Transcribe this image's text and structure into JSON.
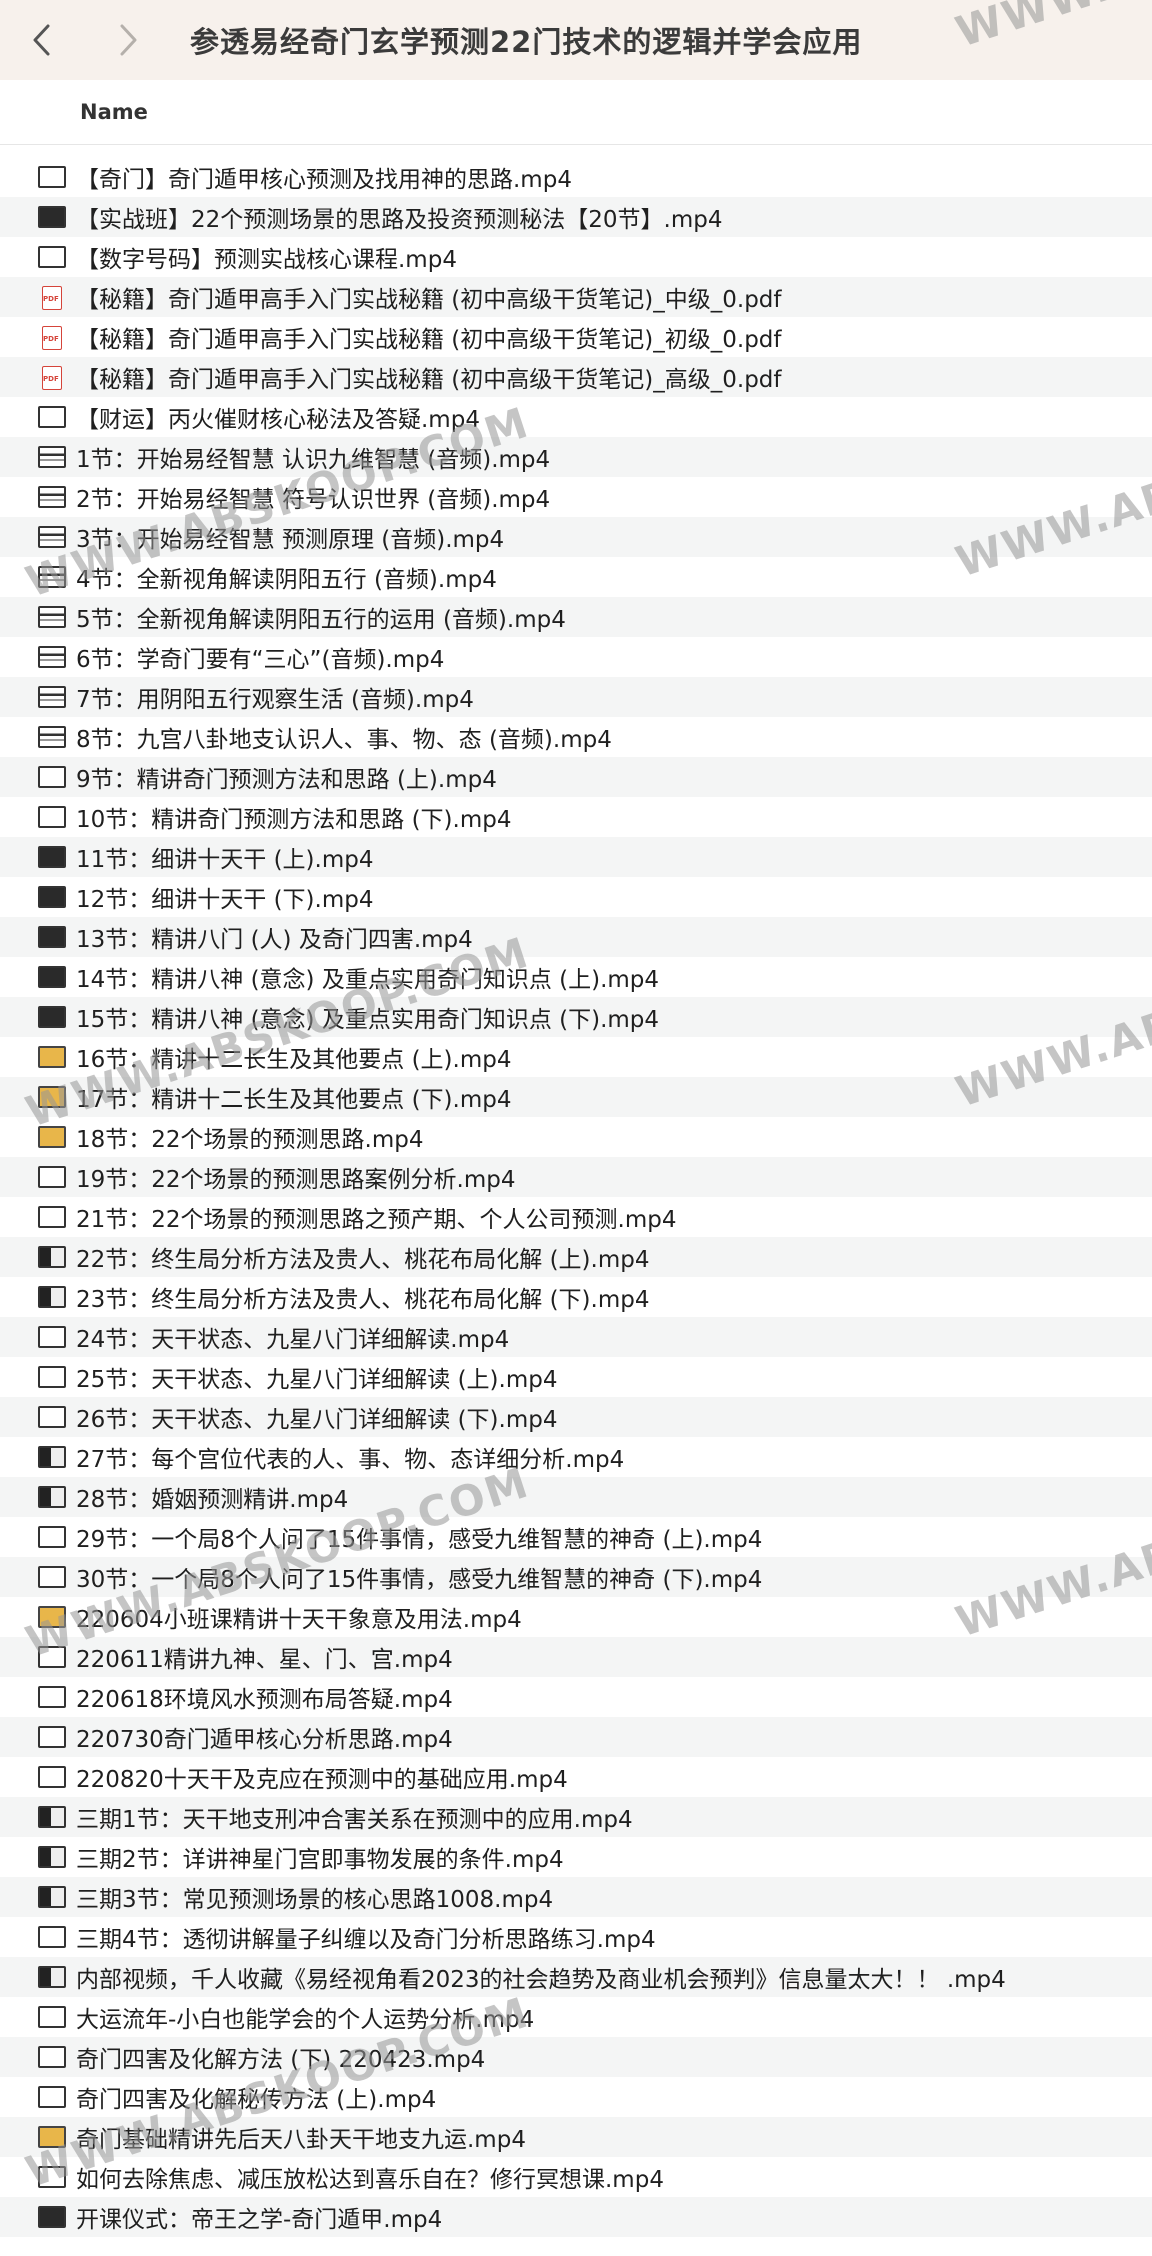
{
  "window": {
    "title": "参透易经奇门玄学预测22门技术的逻辑并学会应用"
  },
  "columns": {
    "name": "Name"
  },
  "watermark": "WWW.ABSKOOP.COM",
  "files": [
    {
      "name": "【奇门】奇门遁甲核心预测及找用神的思路.mp4",
      "icon": "video-icon",
      "style": "plain"
    },
    {
      "name": "【实战班】22个预测场景的思路及投资预测秘法【20节】.mp4",
      "icon": "video-icon",
      "style": "dark"
    },
    {
      "name": "【数字号码】预测实战核心课程.mp4",
      "icon": "video-icon",
      "style": "plain"
    },
    {
      "name": "【秘籍】奇门遁甲高手入门实战秘籍 (初中高级干货笔记)_中级_0.pdf",
      "icon": "pdf-icon",
      "style": "pdf"
    },
    {
      "name": "【秘籍】奇门遁甲高手入门实战秘籍 (初中高级干货笔记)_初级_0.pdf",
      "icon": "pdf-icon",
      "style": "pdf"
    },
    {
      "name": "【秘籍】奇门遁甲高手入门实战秘籍 (初中高级干货笔记)_高级_0.pdf",
      "icon": "pdf-icon",
      "style": "pdf"
    },
    {
      "name": "【财运】丙火催财核心秘法及答疑.mp4",
      "icon": "video-icon",
      "style": "plain"
    },
    {
      "name": "1节：开始易经智慧 认识九维智慧 (音频).mp4",
      "icon": "video-icon",
      "style": "stripe"
    },
    {
      "name": "2节：开始易经智慧 符号认识世界 (音频).mp4",
      "icon": "video-icon",
      "style": "stripe"
    },
    {
      "name": "3节：开始易经智慧 预测原理 (音频).mp4",
      "icon": "video-icon",
      "style": "stripe"
    },
    {
      "name": "4节：全新视角解读阴阳五行 (音频).mp4",
      "icon": "video-icon",
      "style": "stripe"
    },
    {
      "name": "5节：全新视角解读阴阳五行的运用 (音频).mp4",
      "icon": "video-icon",
      "style": "stripe"
    },
    {
      "name": "6节：学奇门要有“三心”(音频).mp4",
      "icon": "video-icon",
      "style": "stripe"
    },
    {
      "name": "7节：用阴阳五行观察生活 (音频).mp4",
      "icon": "video-icon",
      "style": "stripe"
    },
    {
      "name": "8节：九宫八卦地支认识人、事、物、态 (音频).mp4",
      "icon": "video-icon",
      "style": "stripe"
    },
    {
      "name": "9节：精讲奇门预测方法和思路 (上).mp4",
      "icon": "video-icon",
      "style": "plain"
    },
    {
      "name": "10节：精讲奇门预测方法和思路 (下).mp4",
      "icon": "video-icon",
      "style": "plain"
    },
    {
      "name": "11节：细讲十天干 (上).mp4",
      "icon": "video-icon",
      "style": "dark"
    },
    {
      "name": "12节：细讲十天干 (下).mp4",
      "icon": "video-icon",
      "style": "dark"
    },
    {
      "name": "13节：精讲八门 (人) 及奇门四害.mp4",
      "icon": "video-icon",
      "style": "dark"
    },
    {
      "name": "14节：精讲八神 (意念) 及重点实用奇门知识点 (上).mp4",
      "icon": "video-icon",
      "style": "dark"
    },
    {
      "name": "15节：精讲八神 (意念) 及重点实用奇门知识点 (下).mp4",
      "icon": "video-icon",
      "style": "dark"
    },
    {
      "name": "16节：精讲十二长生及其他要点 (上).mp4",
      "icon": "video-icon",
      "style": "gold"
    },
    {
      "name": "17节：精讲十二长生及其他要点 (下).mp4",
      "icon": "video-icon",
      "style": "gold"
    },
    {
      "name": "18节：22个场景的预测思路.mp4",
      "icon": "video-icon",
      "style": "gold"
    },
    {
      "name": "19节：22个场景的预测思路案例分析.mp4",
      "icon": "video-icon",
      "style": "plain"
    },
    {
      "name": "21节：22个场景的预测思路之预产期、个人公司预测.mp4",
      "icon": "video-icon",
      "style": "plain"
    },
    {
      "name": "22节：终生局分析方法及贵人、桃花布局化解 (上).mp4",
      "icon": "video-icon",
      "style": "half"
    },
    {
      "name": "23节：终生局分析方法及贵人、桃花布局化解 (下).mp4",
      "icon": "video-icon",
      "style": "half"
    },
    {
      "name": "24节：天干状态、九星八门详细解读.mp4",
      "icon": "video-icon",
      "style": "plain"
    },
    {
      "name": "25节：天干状态、九星八门详细解读 (上).mp4",
      "icon": "video-icon",
      "style": "plain"
    },
    {
      "name": "26节：天干状态、九星八门详细解读 (下).mp4",
      "icon": "video-icon",
      "style": "plain"
    },
    {
      "name": "27节：每个宫位代表的人、事、物、态详细分析.mp4",
      "icon": "video-icon",
      "style": "half"
    },
    {
      "name": "28节：婚姻预测精讲.mp4",
      "icon": "video-icon",
      "style": "half"
    },
    {
      "name": "29节：一个局8个人问了15件事情，感受九维智慧的神奇 (上).mp4",
      "icon": "video-icon",
      "style": "plain"
    },
    {
      "name": "30节：一个局8个人问了15件事情，感受九维智慧的神奇 (下).mp4",
      "icon": "video-icon",
      "style": "plain"
    },
    {
      "name": "220604小班课精讲十天干象意及用法.mp4",
      "icon": "video-icon",
      "style": "gold"
    },
    {
      "name": "220611精讲九神、星、门、宫.mp4",
      "icon": "video-icon",
      "style": "plain"
    },
    {
      "name": "220618环境风水预测布局答疑.mp4",
      "icon": "video-icon",
      "style": "plain"
    },
    {
      "name": "220730奇门遁甲核心分析思路.mp4",
      "icon": "video-icon",
      "style": "plain"
    },
    {
      "name": "220820十天干及克应在预测中的基础应用.mp4",
      "icon": "video-icon",
      "style": "plain"
    },
    {
      "name": "三期1节：天干地支刑冲合害关系在预测中的应用.mp4",
      "icon": "video-icon",
      "style": "half"
    },
    {
      "name": "三期2节：详讲神星门宫即事物发展的条件.mp4",
      "icon": "video-icon",
      "style": "half"
    },
    {
      "name": "三期3节：常见预测场景的核心思路1008.mp4",
      "icon": "video-icon",
      "style": "half"
    },
    {
      "name": "三期4节：透彻讲解量子纠缠以及奇门分析思路练习.mp4",
      "icon": "video-icon",
      "style": "plain"
    },
    {
      "name": "内部视频，千人收藏《易经视角看2023的社会趋势及商业机会预判》信息量太大！！ .mp4",
      "icon": "video-icon",
      "style": "half"
    },
    {
      "name": "大运流年-小白也能学会的个人运势分析.mp4",
      "icon": "video-icon",
      "style": "plain"
    },
    {
      "name": "奇门四害及化解方法 (下) 220423.mp4",
      "icon": "video-icon",
      "style": "plain"
    },
    {
      "name": "奇门四害及化解秘传方法 (上).mp4",
      "icon": "video-icon",
      "style": "plain"
    },
    {
      "name": "奇门基础精讲先后天八卦天干地支九运.mp4",
      "icon": "video-icon",
      "style": "gold"
    },
    {
      "name": "如何去除焦虑、减压放松达到喜乐自在？修行冥想课.mp4",
      "icon": "video-icon",
      "style": "plain"
    },
    {
      "name": "开课仪式：帝王之学-奇门遁甲.mp4",
      "icon": "video-icon",
      "style": "dark"
    }
  ]
}
